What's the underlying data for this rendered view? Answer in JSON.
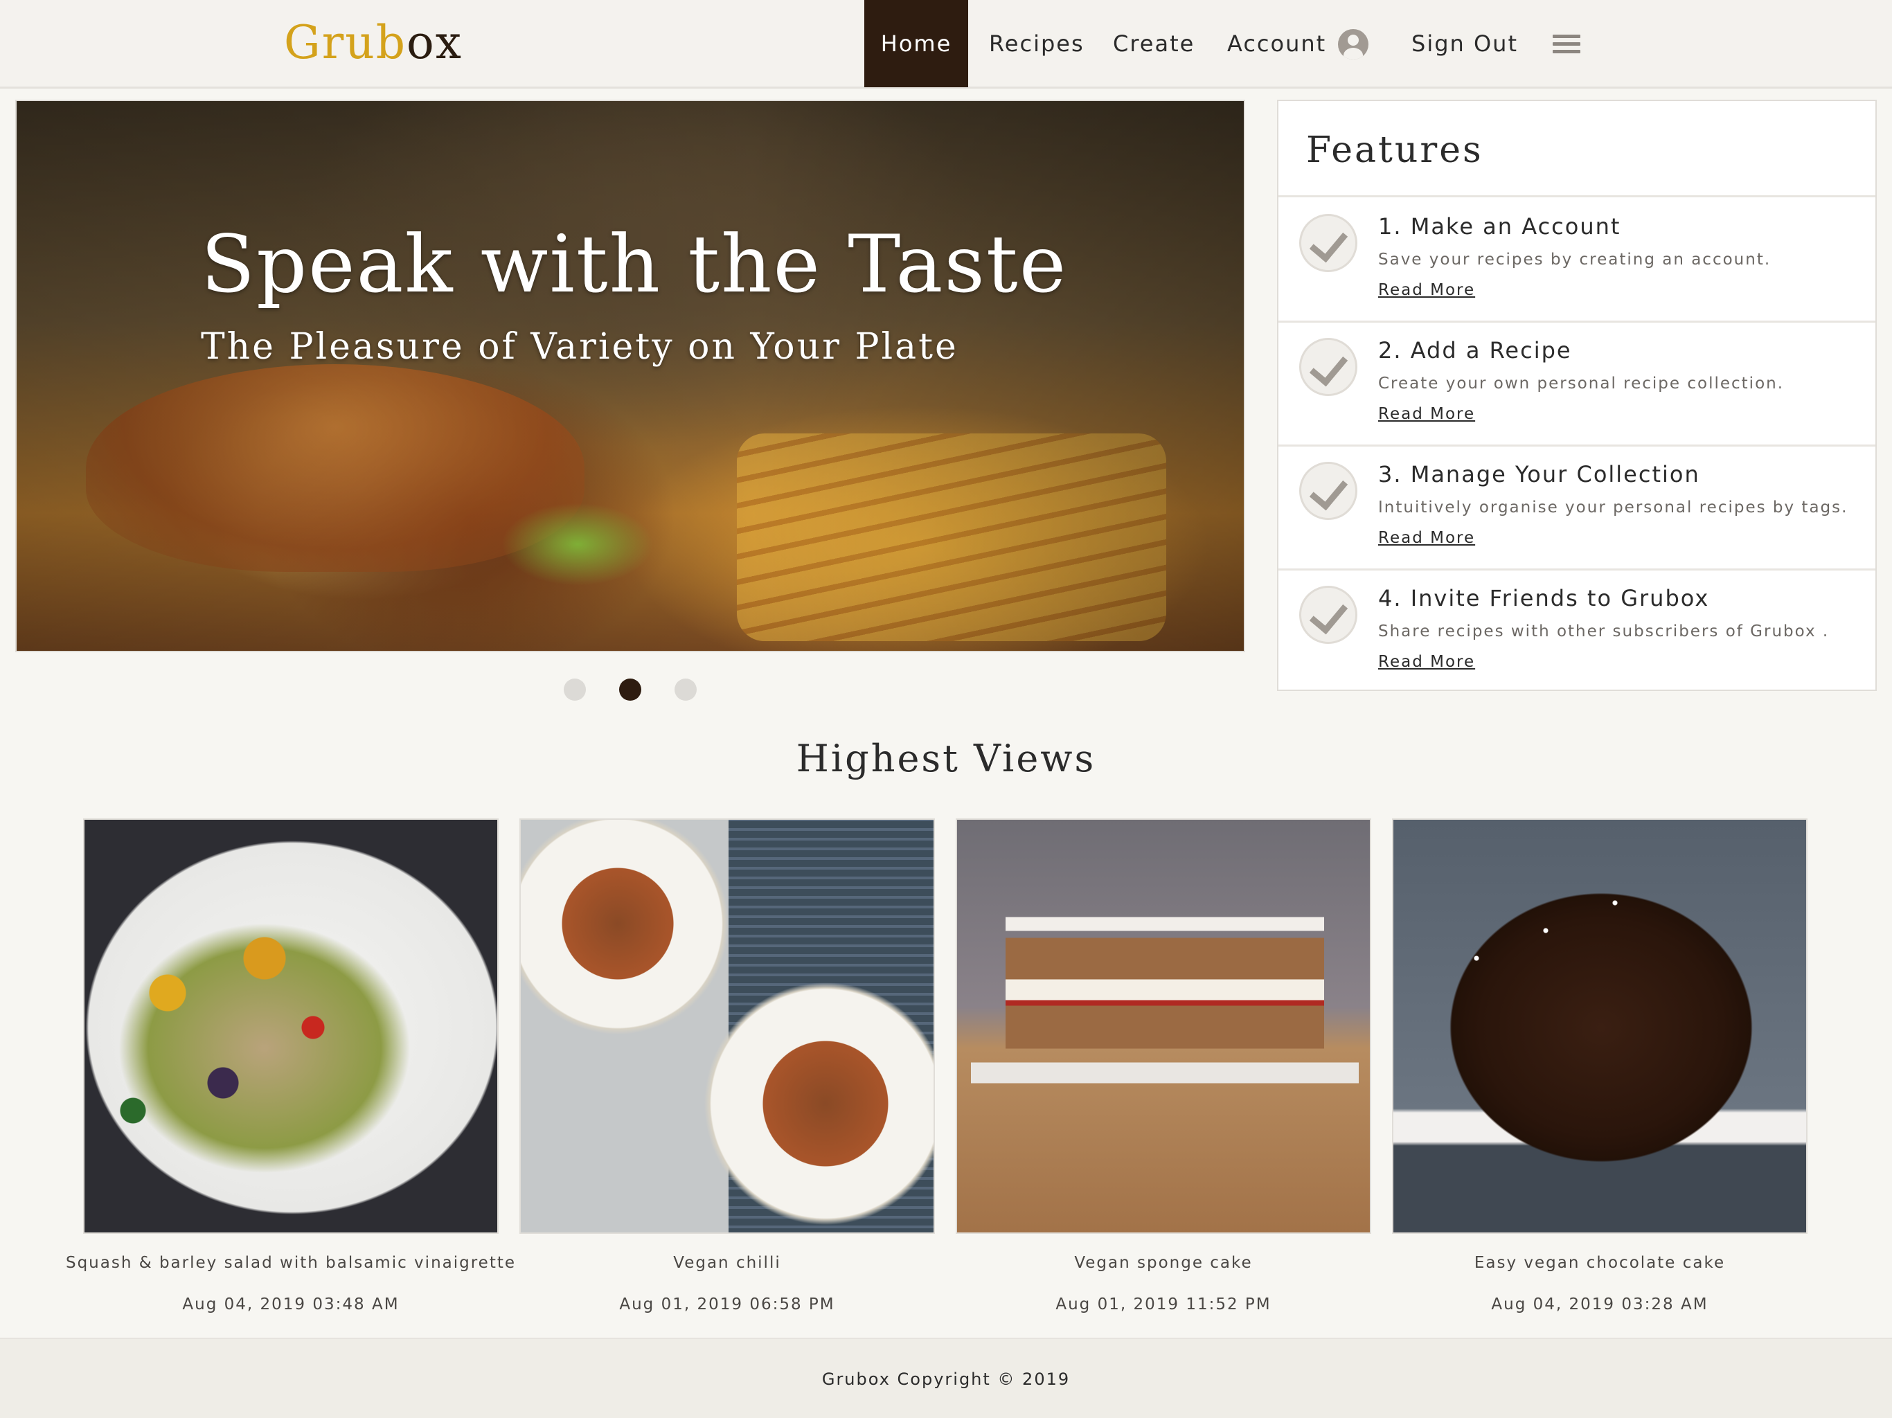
{
  "header": {
    "logo": {
      "part1": "Grub",
      "part2": "ox"
    },
    "nav": {
      "home": "Home",
      "recipes": "Recipes",
      "create": "Create",
      "account": "Account",
      "sign_out": "Sign Out"
    },
    "icons": {
      "account": "user-circle-icon",
      "menu": "hamburger-menu-icon"
    }
  },
  "hero": {
    "title": "Speak with the Taste",
    "subtitle": "The Pleasure of Variety on Your Plate",
    "image": "burger-and-fries-photo",
    "carousel": {
      "slides": 3,
      "active_slide": 2
    }
  },
  "features": {
    "title": "Features",
    "items": [
      {
        "title": "1. Make an Account",
        "description": "Save your recipes by creating an account.",
        "link": "Read More",
        "icon": "check-icon"
      },
      {
        "title": "2. Add a Recipe",
        "description": "Create your own personal recipe collection.",
        "link": "Read More",
        "icon": "check-icon"
      },
      {
        "title": "3. Manage Your Collection",
        "description": "Intuitively organise your personal recipes by tags.",
        "link": "Read More",
        "icon": "check-icon"
      },
      {
        "title": "4. Invite Friends to Grubox",
        "description": "Share recipes with other subscribers of Grubox .",
        "link": "Read More",
        "icon": "check-icon"
      }
    ]
  },
  "highest_views": {
    "title": "Highest Views",
    "recipes": [
      {
        "name": "Squash & barley salad with balsamic vinaigrette",
        "date": "Aug 04, 2019 03:48 AM",
        "image": "squash-barley-salad-photo"
      },
      {
        "name": "Vegan chilli",
        "date": "Aug 01, 2019 06:58 PM",
        "image": "vegan-chilli-photo"
      },
      {
        "name": "Vegan sponge cake",
        "date": "Aug 01, 2019 11:52 PM",
        "image": "vegan-sponge-cake-photo"
      },
      {
        "name": "Easy vegan chocolate cake",
        "date": "Aug 04, 2019 03:28 AM",
        "image": "vegan-chocolate-cake-photo"
      }
    ]
  },
  "footer": {
    "text": "Grubox Copyright © 2019"
  },
  "colors": {
    "brand_gold": "#d4a21b",
    "brand_dark": "#2e1c10",
    "page_background": "#f7f6f2"
  }
}
